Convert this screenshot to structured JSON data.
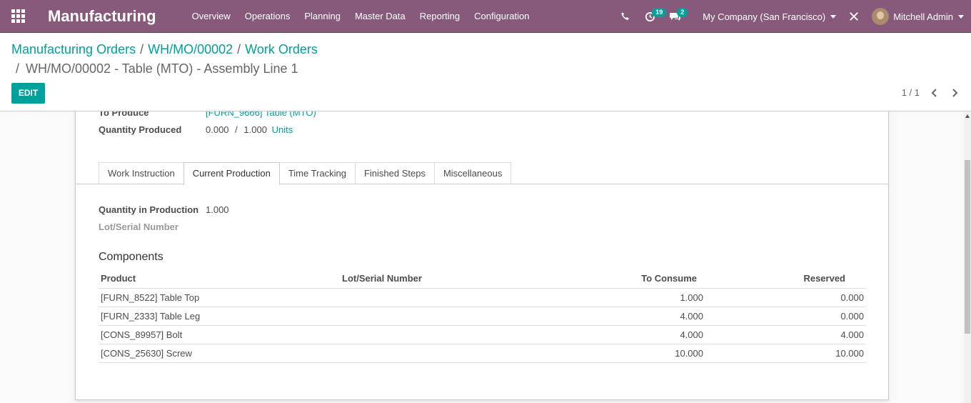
{
  "navbar": {
    "app_name": "Manufacturing",
    "menu": [
      "Overview",
      "Operations",
      "Planning",
      "Master Data",
      "Reporting",
      "Configuration"
    ],
    "activity_count": "19",
    "message_count": "2",
    "company": "My Company (San Francisco)",
    "user": "Mitchell Admin"
  },
  "breadcrumb": {
    "item1": "Manufacturing Orders",
    "item2": "WH/MO/00002",
    "item3": "Work Orders",
    "current": "WH/MO/00002 - Table (MTO) - Assembly Line 1",
    "separator": "/"
  },
  "actions": {
    "edit_label": "EDIT"
  },
  "pager": {
    "value": "1 / 1"
  },
  "form": {
    "to_produce_label": "To Produce",
    "to_produce_value": "[FURN_9666] Table (MTO)",
    "qty_produced_label": "Quantity Produced",
    "qty_produced_value": "0.000",
    "qty_produced_sep": "/",
    "qty_produced_total": "1.000",
    "qty_produced_uom": "Units"
  },
  "tabs": [
    "Work Instruction",
    "Current Production",
    "Time Tracking",
    "Finished Steps",
    "Miscellaneous"
  ],
  "active_tab": "Current Production",
  "current_production": {
    "qty_in_production_label": "Quantity in Production",
    "qty_in_production_value": "1.000",
    "lot_label": "Lot/Serial Number"
  },
  "components": {
    "title": "Components",
    "headers": [
      "Product",
      "Lot/Serial Number",
      "To Consume",
      "Reserved"
    ],
    "rows": [
      {
        "product": "[FURN_8522] Table Top",
        "lot": "",
        "to_consume": "1.000",
        "reserved": "0.000"
      },
      {
        "product": "[FURN_2333] Table Leg",
        "lot": "",
        "to_consume": "4.000",
        "reserved": "0.000"
      },
      {
        "product": "[CONS_89957] Bolt",
        "lot": "",
        "to_consume": "4.000",
        "reserved": "4.000"
      },
      {
        "product": "[CONS_25630] Screw",
        "lot": "",
        "to_consume": "10.000",
        "reserved": "10.000"
      }
    ]
  },
  "colors": {
    "navbar": "#875a7b",
    "accent": "#00a09d"
  }
}
